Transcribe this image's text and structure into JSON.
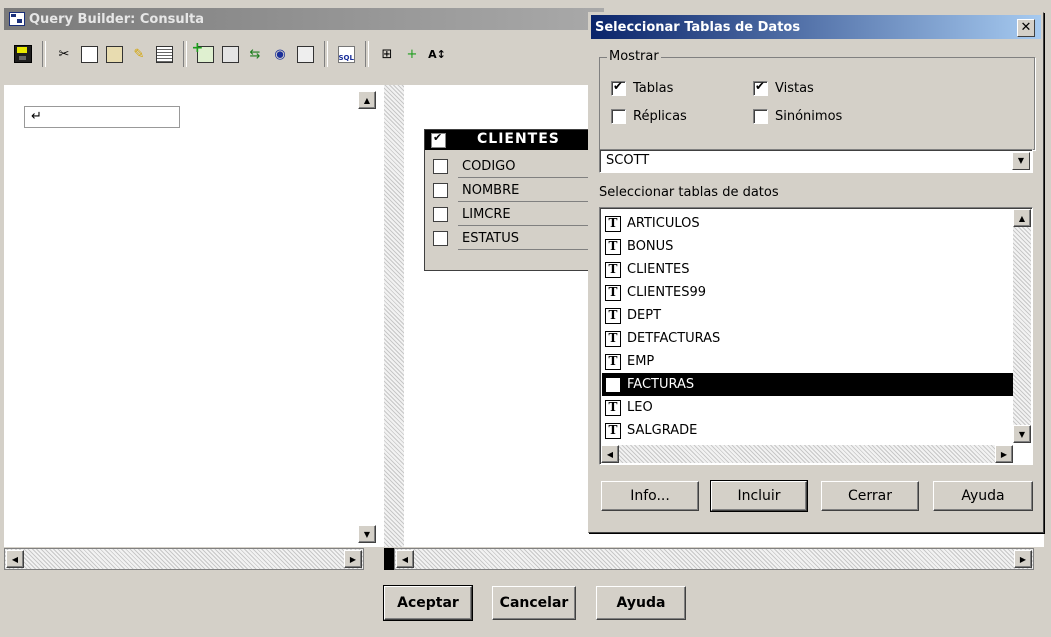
{
  "main_window": {
    "title": "Query Builder: Consulta",
    "query_text": "↵"
  },
  "table_widget": {
    "title": "CLIENTES",
    "columns": [
      "CODIGO",
      "NOMBRE",
      "LIMCRE",
      "ESTATUS"
    ]
  },
  "bottom_buttons": {
    "accept": "Aceptar",
    "cancel": "Cancelar",
    "help": "Ayuda"
  },
  "dialog": {
    "title": "Seleccionar Tablas de Datos",
    "close": "✕",
    "group_label": "Mostrar",
    "checkboxes": {
      "tables": {
        "label": "Tablas",
        "checked": true
      },
      "views": {
        "label": "Vistas",
        "checked": true
      },
      "replicas": {
        "label": "Réplicas",
        "checked": false
      },
      "synonyms": {
        "label": "Sinónimos",
        "checked": false
      }
    },
    "owner": "SCOTT",
    "list_label": "Seleccionar tablas de datos",
    "tables": [
      "ARTICULOS",
      "BONUS",
      "CLIENTES",
      "CLIENTES99",
      "DEPT",
      "DETFACTURAS",
      "EMP",
      "FACTURAS",
      "LEO",
      "SALGRADE"
    ],
    "selected_table": "FACTURAS",
    "buttons": {
      "info": "Info...",
      "include": "Incluir",
      "close": "Cerrar",
      "help": "Ayuda"
    }
  },
  "icons": {
    "table_type": "T",
    "scroll_up": "▲",
    "scroll_down": "▼",
    "scroll_left": "◀",
    "scroll_right": "▶"
  }
}
